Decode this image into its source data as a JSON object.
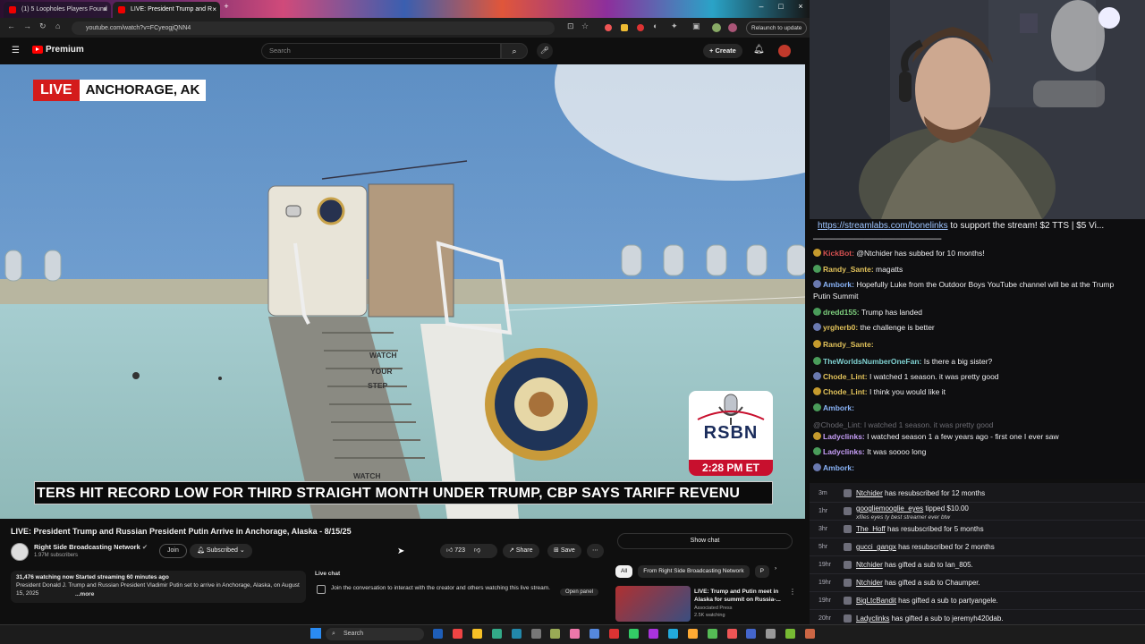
{
  "browser": {
    "tabs": [
      {
        "label": "(1) 5 Loopholes Players Found"
      },
      {
        "label": "LIVE: President Trump and R"
      }
    ],
    "url": "youtube.com/watch?v=FCyeogjQNN4",
    "relaunch": "Relaunch to update"
  },
  "youtube": {
    "logo": "Premium",
    "search_placeholder": "Search",
    "create": "Create",
    "live_label": "LIVE",
    "location": "ANCHORAGE, AK",
    "ticker": "TERS HIT RECORD LOW FOR THIRD STRAIGHT MONTH UNDER TRUMP, CBP SAYS    TARIFF REVENU",
    "rsbn_logo": "RSBN",
    "rsbn_time": "2:28 PM ET",
    "plane_text": [
      "WATCH",
      "YOUR",
      "STEP"
    ],
    "stair_text": "WATCH",
    "title": "LIVE: President Trump and Russian President Putin Arrive in Anchorage, Alaska - 8/15/25",
    "channel": "Right Side Broadcasting Network",
    "subs": "1.97M subscribers",
    "join": "Join",
    "subscribed": "Subscribed",
    "likes": "723",
    "share": "Share",
    "save": "Save",
    "desc_stats": "31,476 watching now  Started streaming 60 minutes ago",
    "desc_text": "President Donald J. Trump and Russian President Vladimir Putin set to arrive in Anchorage, Alaska, on August 15, 2025",
    "desc_more": "...more",
    "live_chat_title": "Live chat",
    "live_chat_text": "Join the conversation to interact with the creator and others watching this live stream.",
    "open_panel": "Open panel",
    "show_chat": "Show chat",
    "chips": [
      "All",
      "From Right Side Broadcasting Network",
      "P"
    ],
    "rec": {
      "title": "LIVE: Trump and Putin meet in Alaska for summit on Russia-...",
      "channel": "Associated Press",
      "views": "2.5K watching"
    }
  },
  "stream": {
    "banner_link": "https://streamlabs.com/bonelinks",
    "banner_text": " to support the stream! $2 TTS | $5 Vi...",
    "chat": [
      {
        "user": "KickBot:",
        "color": "#d45050",
        "text": " @Ntchider has subbed for 10 months!"
      },
      {
        "user": "Randy_Sante:",
        "color": "#e0c15a",
        "text": " magatts"
      },
      {
        "user": "Ambork:",
        "color": "#8ab4f8",
        "text": " Hopefully Luke from the Outdoor Boys YouTube channel will be at the Trump"
      },
      {
        "user": "",
        "color": "#efeff1",
        "text": "Putin Summit"
      },
      {
        "user": "dredd155:",
        "color": "#7fd17f",
        "text": " Trump has landed"
      },
      {
        "user": "yrgherb0:",
        "color": "#e0c15a",
        "text": " the challenge is better"
      },
      {
        "user": "Randy_Sante:",
        "color": "#e0c15a",
        "text": " "
      },
      {
        "user": "TheWorldsNumberOneFan:",
        "color": "#7fd1d1",
        "text": " Is there a big sister?"
      },
      {
        "user": "Chode_Lint:",
        "color": "#e0c15a",
        "text": " I watched 1 season. it was pretty good"
      },
      {
        "user": "Chode_Lint:",
        "color": "#e0c15a",
        "text": " I think you would like it"
      },
      {
        "user": "Ambork:",
        "color": "#8ab4f8",
        "text": " "
      },
      {
        "user": "",
        "color": "#6b6b72",
        "text": "@Chode_Lint: I watched 1 season. it was pretty good"
      },
      {
        "user": "Ladyclinks:",
        "color": "#c69ef7",
        "text": " I watched season 1 a few years ago - first one I ever saw"
      },
      {
        "user": "Ladyclinks:",
        "color": "#c69ef7",
        "text": " It was soooo long"
      },
      {
        "user": "Ambork:",
        "color": "#8ab4f8",
        "text": " "
      }
    ],
    "events": [
      {
        "time": "3m",
        "user": "Ntchider",
        "text": " has resubscribed for 12 months"
      },
      {
        "time": "1hr",
        "user": "googliemooglie_eyes",
        "text": " tipped $10.00",
        "sub": "xfiles eyes ty best streamer ever btw"
      },
      {
        "time": "3hr",
        "user": "The_Hoff",
        "text": " has resubscribed for 5 months"
      },
      {
        "time": "5hr",
        "user": "gucci_gangx",
        "text": " has resubscribed for 2 months"
      },
      {
        "time": "19hr",
        "user": "Ntchider",
        "text": " has gifted a sub to Ian_805."
      },
      {
        "time": "19hr",
        "user": "Ntchider",
        "text": " has gifted a sub to Chaumper."
      },
      {
        "time": "19hr",
        "user": "BigLtcBandit",
        "text": " has gifted a sub to partyangele."
      },
      {
        "time": "20hr",
        "user": "Ladyclinks",
        "text": " has gifted a sub to jeremyh420dab."
      }
    ]
  },
  "taskbar": {
    "search": "Search"
  }
}
